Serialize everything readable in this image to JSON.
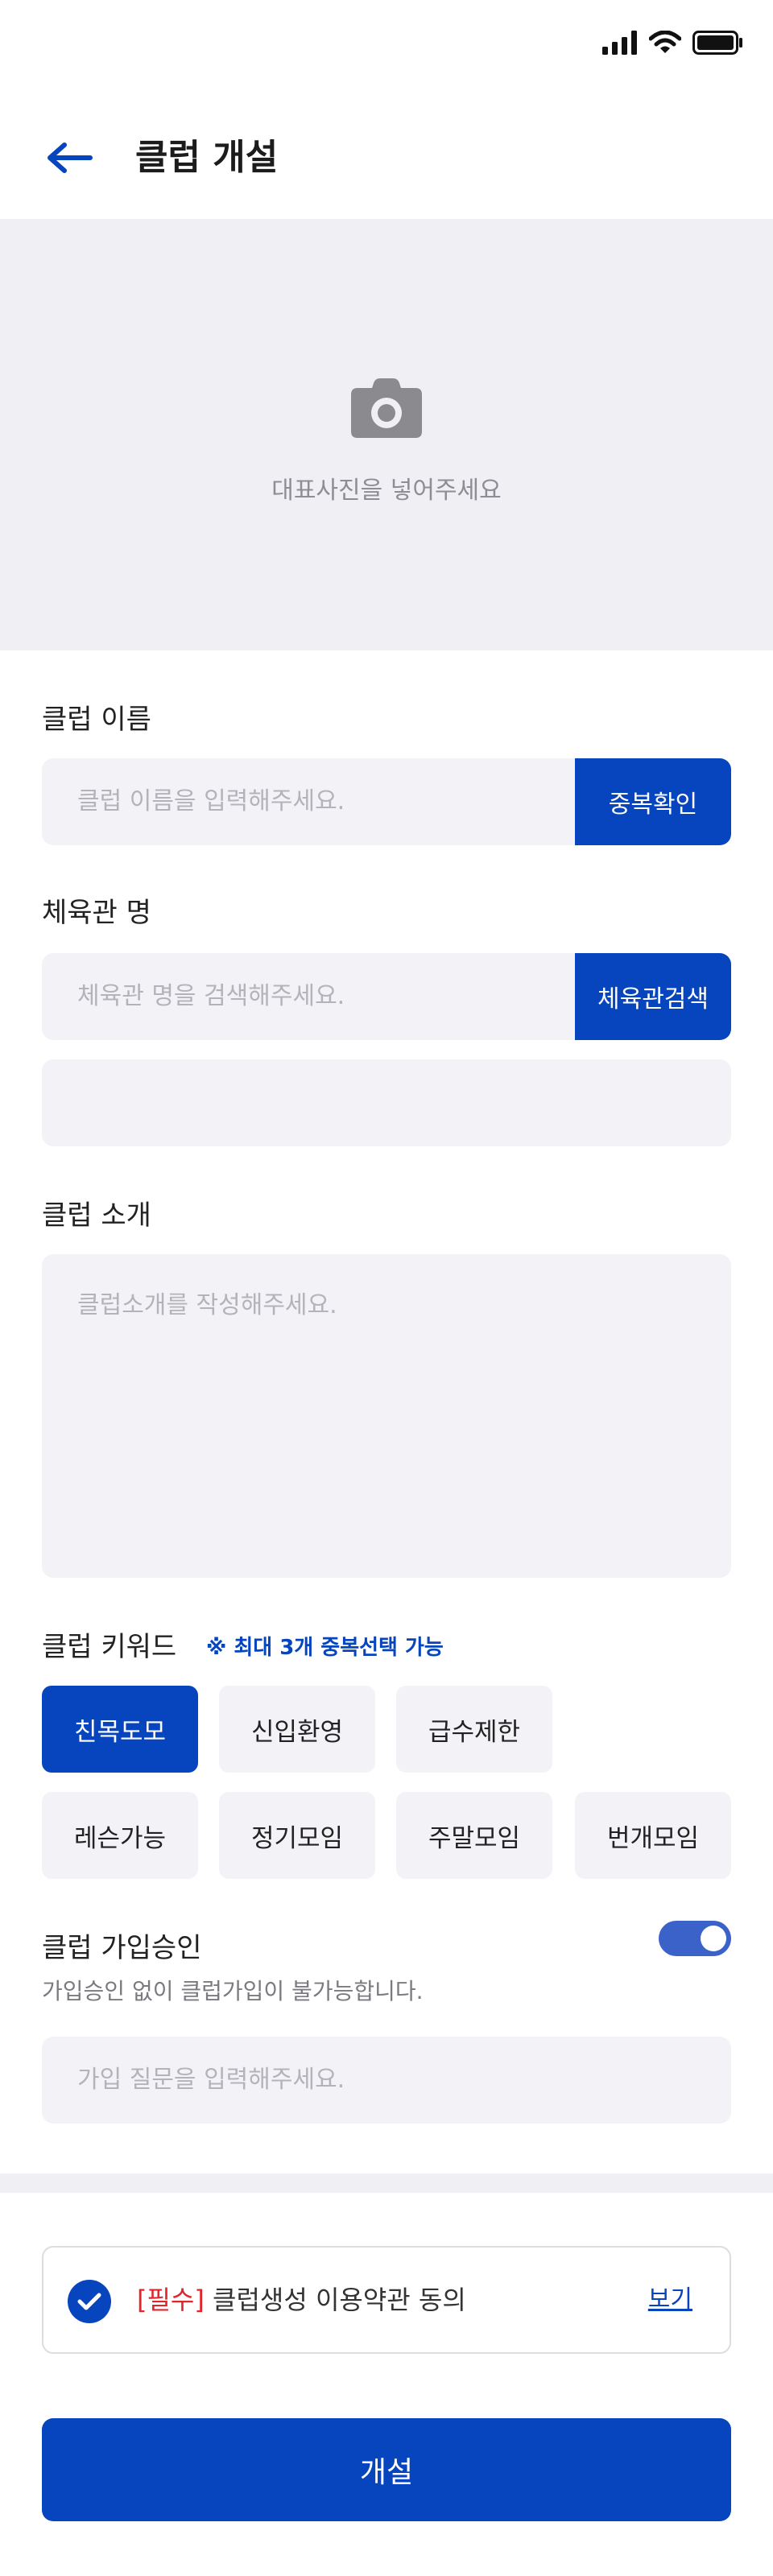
{
  "header": {
    "title": "클럽 개설",
    "back_icon": "arrow-left-icon"
  },
  "photo": {
    "icon": "camera-icon",
    "text": "대표사진을 넣어주세요"
  },
  "club_name": {
    "label": "클럽 이름",
    "placeholder": "클럽 이름을 입력해주세요.",
    "button": "중복확인"
  },
  "gym": {
    "label": "체육관 명",
    "placeholder": "체육관 명을 검색해주세요.",
    "button": "체육관검색",
    "address_value": ""
  },
  "intro": {
    "label": "클럽 소개",
    "placeholder": "클럽소개를 작성해주세요."
  },
  "keywords": {
    "label": "클럽 키워드",
    "note": "※ 최대 3개 중복선택 가능",
    "chips": [
      {
        "label": "친목도모",
        "selected": true
      },
      {
        "label": "신입환영",
        "selected": false
      },
      {
        "label": "급수제한",
        "selected": false
      },
      {
        "label": "레슨가능",
        "selected": false
      },
      {
        "label": "정기모임",
        "selected": false
      },
      {
        "label": "주말모임",
        "selected": false
      },
      {
        "label": "번개모임",
        "selected": false
      }
    ]
  },
  "approval": {
    "label": "클럽 가입승인",
    "description": "가입승인 없이 클럽가입이 불가능합니다.",
    "toggle_on": true,
    "question_placeholder": "가입 질문을 입력해주세요."
  },
  "terms": {
    "required_tag": "[필수]",
    "text": "클럽생성 이용약관 동의",
    "view_link": "보기",
    "checked": true
  },
  "submit": {
    "label": "개설"
  },
  "colors": {
    "primary": "#0645be",
    "toggle": "#3a62c9",
    "required": "#e0262b",
    "field_bg": "#f3f3f7",
    "placeholder": "#b3b3b9"
  }
}
